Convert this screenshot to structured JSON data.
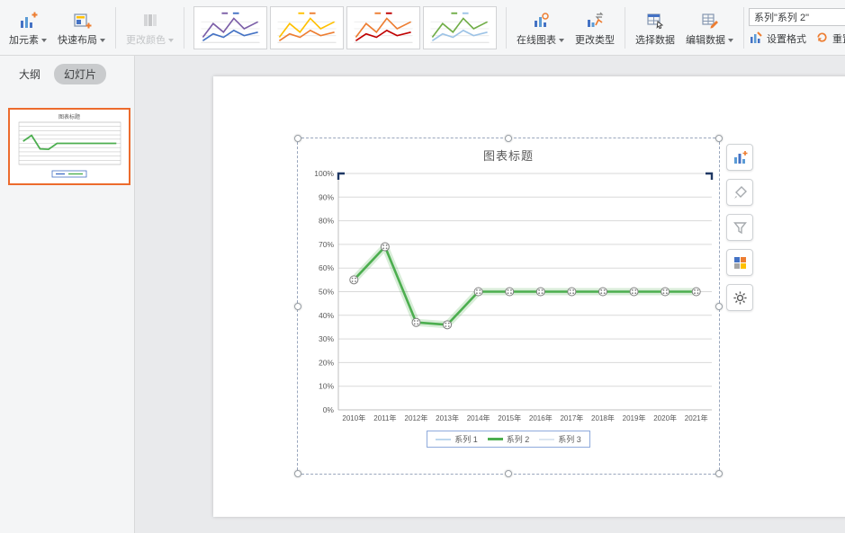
{
  "ribbon": {
    "add_element": {
      "label": "加元素"
    },
    "quick_layout": {
      "label": "快速布局"
    },
    "change_colors": {
      "label": "更改颜色"
    },
    "online_chart": {
      "label": "在线图表"
    },
    "change_type": {
      "label": "更改类型"
    },
    "select_data": {
      "label": "选择数据"
    },
    "edit_data": {
      "label": "编辑数据"
    },
    "series_selector_value": "系列\"系列 2\"",
    "set_format": {
      "label": "设置格式"
    },
    "reset": {
      "label": "重置"
    },
    "gallery": [
      {
        "name": "chart-style-1",
        "colors": [
          "#7b5ea7",
          "#4472c4"
        ]
      },
      {
        "name": "chart-style-2",
        "colors": [
          "#ffc000",
          "#ed7d31"
        ]
      },
      {
        "name": "chart-style-3",
        "colors": [
          "#ed7d31",
          "#c00000"
        ]
      },
      {
        "name": "chart-style-4",
        "colors": [
          "#70ad47",
          "#9dc3e6"
        ]
      }
    ]
  },
  "sidebar": {
    "tab_outline": "大纲",
    "tab_slides": "幻灯片"
  },
  "chart_data": {
    "type": "line",
    "title": "图表标题",
    "categories": [
      "2010年",
      "2011年",
      "2012年",
      "2013年",
      "2014年",
      "2015年",
      "2016年",
      "2017年",
      "2018年",
      "2019年",
      "2020年",
      "2021年"
    ],
    "series": [
      {
        "name": "系列 1",
        "color": "#bdd7ee",
        "values": []
      },
      {
        "name": "系列 2",
        "color": "#4cae4f",
        "values": [
          55,
          69,
          37,
          36,
          50,
          50,
          50,
          50,
          50,
          50,
          50,
          50
        ]
      },
      {
        "name": "系列 3",
        "color": "#dce6f1",
        "values": []
      }
    ],
    "ytick_labels": [
      "0%",
      "10%",
      "20%",
      "30%",
      "40%",
      "50%",
      "60%",
      "70%",
      "80%",
      "90%",
      "100%"
    ],
    "ylim": [
      0,
      100
    ],
    "grid": true,
    "legend_position": "bottom"
  },
  "colors": {
    "thumbnail_selection": "#ec6b2d",
    "series2_green": "#4cae4f",
    "gridline": "#d9d9d9",
    "axis_label": "#595959",
    "plot_corner_mark": "#1f3864"
  },
  "icons": {
    "add_element": "chart-with-plus",
    "quick_layout": "layout-grid-plus",
    "change_colors": "color-bars",
    "online_chart": "column-chart-online",
    "change_type": "chart-type-swap",
    "select_data": "table-select",
    "edit_data": "table-edit",
    "set_format": "format-chart",
    "reset": "reset-arrow",
    "float_tools": [
      "chart-elements",
      "style-brush",
      "filter-funnel",
      "data-grid",
      "settings-gear"
    ],
    "dropdown_caret": "caret-down"
  }
}
